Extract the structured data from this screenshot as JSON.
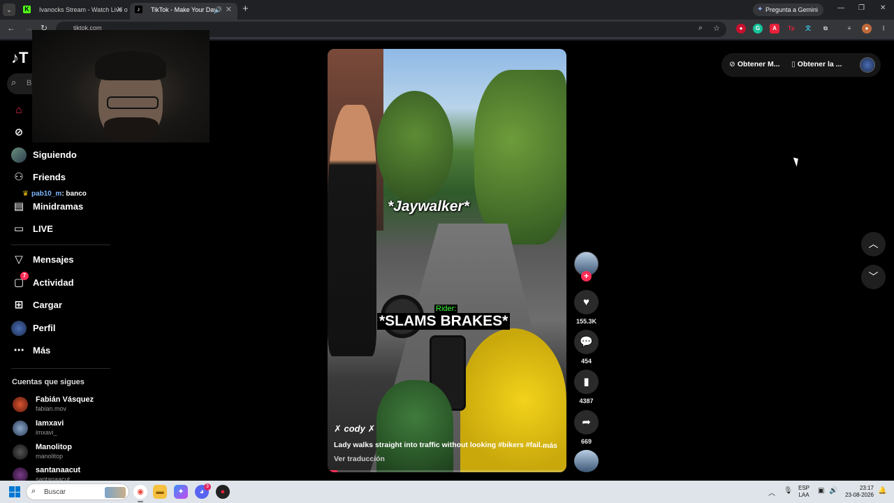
{
  "browser": {
    "tabs": [
      {
        "title": "Ivanocks Stream - Watch Live o",
        "favicon": "kick-icon"
      },
      {
        "title": "TikTok - Make Your Day",
        "favicon": "tiktok-icon"
      }
    ],
    "gemini_label": "Pregunta a Gemini",
    "url": "tiktok.com"
  },
  "sidebar": {
    "search_placeholder": "B",
    "nav": [
      {
        "label": "",
        "icon": "home-icon"
      },
      {
        "label": "",
        "icon": "compass-icon"
      },
      {
        "label": "Siguiendo",
        "icon": "avatar"
      },
      {
        "label": "Friends",
        "icon": "friends-icon"
      },
      {
        "label": "Minidramas",
        "icon": "film-icon"
      },
      {
        "label": "LIVE",
        "icon": "tv-icon"
      },
      {
        "label": "Mensajes",
        "icon": "send-icon"
      },
      {
        "label": "Actividad",
        "icon": "activity-icon",
        "badge": "7"
      },
      {
        "label": "Cargar",
        "icon": "upload-icon"
      },
      {
        "label": "Perfil",
        "icon": "avatar"
      },
      {
        "label": "Más",
        "icon": "more-icon"
      }
    ],
    "chat_overlay": {
      "user": "pab10_m",
      "message": ": banco"
    },
    "following_title": "Cuentas que sigues",
    "following": [
      {
        "name": "Fabián Vásquez",
        "handle": "fabian.mov"
      },
      {
        "name": "Iamxavi",
        "handle": "imxavi_"
      },
      {
        "name": "Manolitop",
        "handle": "manolitop"
      },
      {
        "name": "santanaacut",
        "handle": "santanaacut"
      }
    ]
  },
  "video": {
    "caption_top": "*Jaywalker*",
    "caption_label": "Rider:",
    "caption_main": "*SLAMS BRAKES*",
    "author": "✗ cody ✗",
    "description": "Lady walks straight into traffic without looking #bikers #fail...",
    "more": "más",
    "translate": "Ver traducción",
    "progress": 0.04
  },
  "actions": {
    "likes": "155.3K",
    "comments": "454",
    "saves": "4387",
    "shares": "669"
  },
  "topbar": {
    "get_coins": "Obtener M...",
    "get_app": "Obtener la ..."
  },
  "taskbar": {
    "search": "Buscar",
    "lang_top": "ESP",
    "lang_bottom": "LAA",
    "time": "23:17",
    "date": "23-08-2026",
    "discord_badge": "3"
  },
  "colors": {
    "tiktok_accent": "#fe2c55",
    "background": "#000000",
    "taskbar": "#dfe4ea"
  }
}
